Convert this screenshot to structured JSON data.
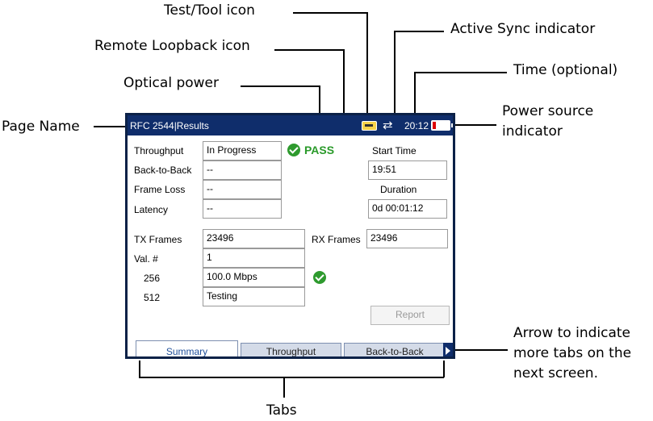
{
  "callouts": {
    "test_tool_icon": "Test/Tool icon",
    "active_sync": "Active Sync indicator",
    "remote_loopback": "Remote Loopback icon",
    "time_optional": "Time (optional)",
    "optical_power": "Optical power",
    "power_source_1": "Power source",
    "power_source_2": "indicator",
    "page_name": "Page Name",
    "arrow_1": "Arrow to indicate",
    "arrow_2": "more tabs on the",
    "arrow_3": "next screen.",
    "tabs": "Tabs"
  },
  "screen": {
    "title": "RFC 2544|Results",
    "time": "20:12",
    "icons": [
      "remote-loopback-icon",
      "active-sync-icon",
      "battery-icon"
    ],
    "battery_level": 0.2,
    "results": {
      "throughput_label": "Throughput",
      "throughput_value": "In Progress",
      "pass_text": "PASS",
      "back_to_back_label": "Back-to-Back",
      "back_to_back_value": "--",
      "frame_loss_label": "Frame Loss",
      "frame_loss_value": "--",
      "latency_label": "Latency",
      "latency_value": "--"
    },
    "timing": {
      "start_time_label": "Start Time",
      "start_time_value": "19:51",
      "duration_label": "Duration",
      "duration_value": "0d 00:01:12"
    },
    "frames": {
      "tx_label": "TX Frames",
      "tx_value": "23496",
      "rx_label": "RX Frames",
      "rx_value": "23496",
      "val_label": "Val. #",
      "val_value": "1",
      "row1_label": "256",
      "row1_value": "100.0 Mbps",
      "row2_label": "512",
      "row2_value": "Testing"
    },
    "report_button": "Report",
    "tabs": [
      "Summary",
      "Throughput",
      "Back-to-Back"
    ]
  }
}
